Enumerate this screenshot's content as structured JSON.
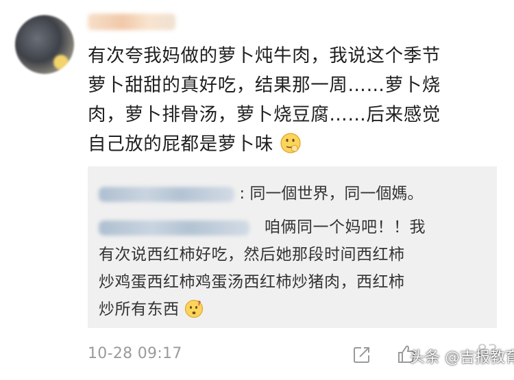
{
  "comment": {
    "lines": [
      "有次夸我妈做的萝卜炖牛肉，我说这个季节",
      "萝卜甜甜的真好吃，结果那一周……萝卜烧",
      "肉，萝卜排骨汤，萝卜烧豆腐……后来感觉",
      "自己放的屁都是萝卜味"
    ],
    "emoji": "smirk-face-emoji"
  },
  "replies": [
    {
      "text": ": 同一個世界，同一個媽。"
    },
    {
      "lines": [
        "咱俩同一个妈吧！！我",
        "有次说西红柿好吃，然后她那段时间西红柿",
        "炒鸡蛋西红柿鸡蛋汤西红柿炒猪肉，西红柿",
        "炒所有东西"
      ],
      "emoji": "thinking-face-emoji"
    }
  ],
  "footer": {
    "timestamp": "10-28 09:17",
    "like_count": "83",
    "watermark": "头条 @吉报教育"
  },
  "colors": {
    "reply_bg": "#f0f0f0",
    "timestamp": "#9a9a9a",
    "text": "#1e1e1e"
  }
}
